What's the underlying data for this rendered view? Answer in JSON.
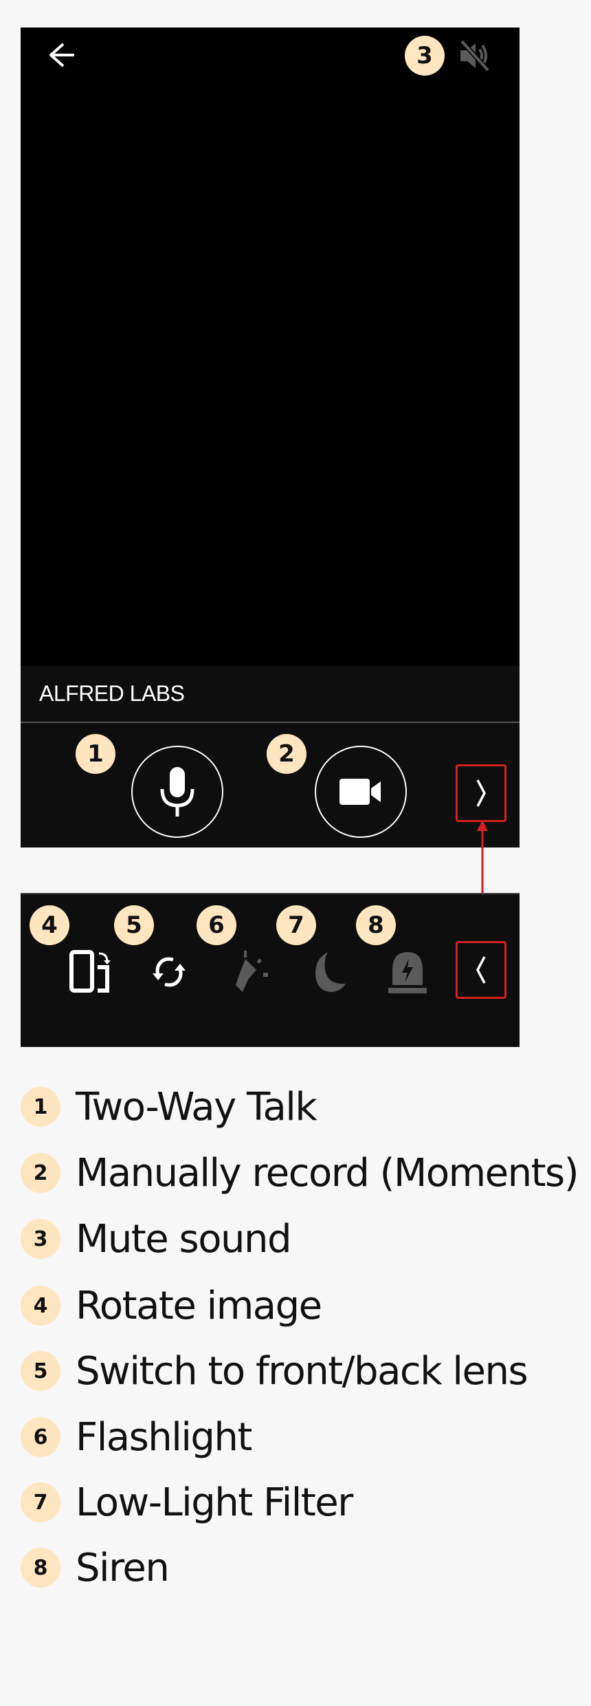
{
  "header": {
    "back_icon": "arrow-left-icon",
    "mute_icon": "volume-mute-icon",
    "mute_badge": "3"
  },
  "camera": {
    "name": "ALFRED LABS"
  },
  "controls": {
    "talk_badge": "1",
    "talk_icon": "microphone-icon",
    "record_badge": "2",
    "record_icon": "video-camera-icon",
    "expand_icon": "chevron-right-icon"
  },
  "toolbar2": {
    "items": [
      {
        "badge": "4",
        "icon": "rotate-screen-icon",
        "enabled": true
      },
      {
        "badge": "5",
        "icon": "switch-camera-icon",
        "enabled": true
      },
      {
        "badge": "6",
        "icon": "flashlight-icon",
        "enabled": false
      },
      {
        "badge": "7",
        "icon": "moon-icon",
        "enabled": false
      },
      {
        "badge": "8",
        "icon": "siren-icon",
        "enabled": false
      }
    ],
    "collapse_icon": "chevron-left-icon"
  },
  "colors": {
    "badge": "#ffe6c0",
    "highlight": "#d42020",
    "disabled_icon": "#5a5a5a"
  },
  "legend": [
    {
      "num": "1",
      "label": "Two-Way Talk"
    },
    {
      "num": "2",
      "label": "Manually record (Moments)"
    },
    {
      "num": "3",
      "label": "Mute sound"
    },
    {
      "num": "4",
      "label": "Rotate image"
    },
    {
      "num": "5",
      "label": "Switch to front/back lens"
    },
    {
      "num": "6",
      "label": "Flashlight"
    },
    {
      "num": "7",
      "label": "Low-Light Filter"
    },
    {
      "num": "8",
      "label": "Siren"
    }
  ]
}
